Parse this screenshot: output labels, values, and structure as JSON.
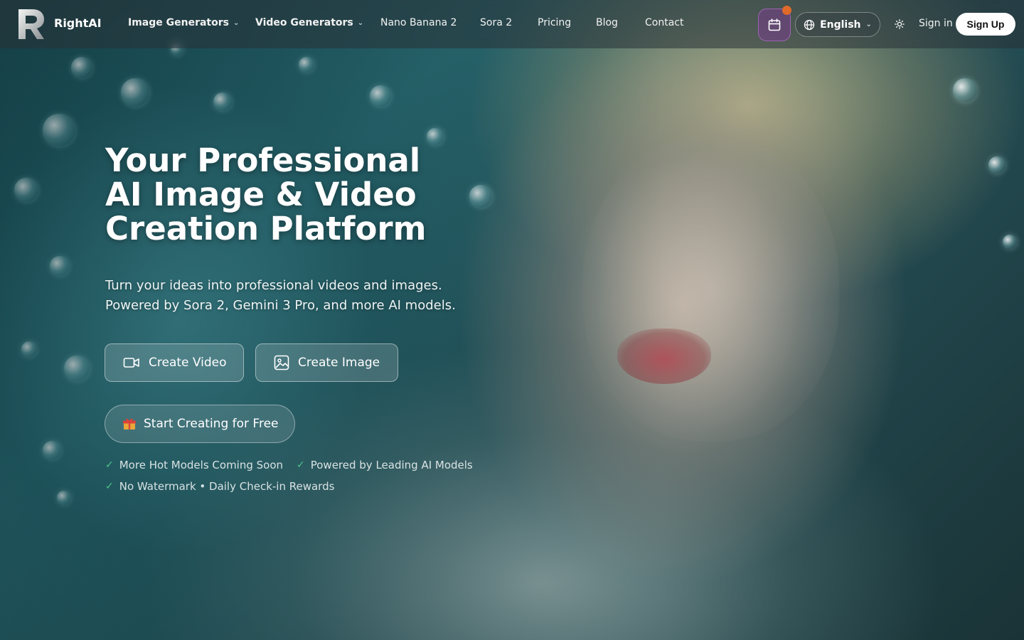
{
  "brand": {
    "name": "RightAI"
  },
  "nav": {
    "image_generators": "Image Generators",
    "video_generators": "Video Generators",
    "nano_banana": "Nano Banana 2",
    "sora": "Sora 2",
    "pricing": "Pricing",
    "blog": "Blog",
    "contact": "Contact"
  },
  "header_actions": {
    "language": "English",
    "sign_in": "Sign in",
    "sign_up": "Sign Up"
  },
  "hero": {
    "title_lines": [
      "Your Professional",
      "AI Image & Video",
      "Creation Platform"
    ],
    "subtitle_lines": [
      "Turn your ideas into professional videos and images.",
      "Powered by Sora 2, Gemini 3 Pro, and more AI models."
    ],
    "create_video": "Create Video",
    "create_image": "Create Image",
    "start_free": "Start Creating for Free",
    "features": [
      "More Hot Models Coming Soon",
      "Powered by Leading AI Models",
      "No Watermark • Daily Check-in Rewards"
    ]
  },
  "icons": {
    "logo": "rightai-logo-icon",
    "calendar": "calendar-icon",
    "notification_dot": "notification-dot",
    "globe": "globe-icon",
    "theme": "sun-icon",
    "video": "video-camera-icon",
    "image": "image-icon",
    "gift": "gift-icon",
    "check": "check-icon"
  },
  "colors": {
    "accent_purple": "#7a3c8c",
    "notification": "#e06a2a",
    "check_green": "#4ec48a"
  }
}
